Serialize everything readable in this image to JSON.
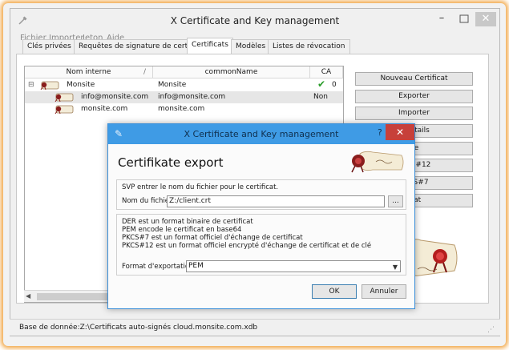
{
  "main_window": {
    "title": "X Certificate and Key management",
    "menu": [
      "Fichier",
      "Importer",
      "Jeton",
      "Aide"
    ],
    "tabs": [
      {
        "label": "Clés privées",
        "active": false
      },
      {
        "label": "Requêtes de signature de certificat",
        "active": false
      },
      {
        "label": "Certificats",
        "active": true
      },
      {
        "label": "Modèles",
        "active": false
      },
      {
        "label": "Listes de révocation",
        "active": false
      }
    ],
    "list": {
      "columns": [
        "Nom interne",
        "commonName",
        "CA"
      ],
      "rows": [
        {
          "name": "Monsite",
          "common_name": "Monsite",
          "ca": "0",
          "ca_check": true,
          "expand": "⊟"
        },
        {
          "name": "info@monsite.com",
          "common_name": "info@monsite.com",
          "ca": "Non"
        },
        {
          "name": "monsite.com",
          "common_name": "monsite.com",
          "ca": ""
        }
      ]
    },
    "buttons": [
      "Nouveau Certificat",
      "Exporter",
      "Importer",
      "s Détails",
      "ire",
      "PKCS#12",
      "PKCS#7",
      "plat"
    ],
    "status": "Base de donnée:Z:\\Certificats auto-signés cloud.monsite.com.xdb"
  },
  "dialog": {
    "title": "X Certificate and Key management",
    "help": "?",
    "close": "✕",
    "heading": "Certifikate export",
    "instruction": "SVP entrer le nom du fichier pour le certificat.",
    "filename_label": "Nom du fichier",
    "filename_value": "Z:/client.crt",
    "browse_label": "...",
    "format_info": [
      "DER est un format binaire de certificat",
      "PEM encode le certificat en base64",
      "PKCS#7 est un format officiel d'échange de certificat",
      "PKCS#12 est un format officiel encrypté d'échange de certificat et de clé"
    ],
    "format_label": "Format d'exportation",
    "format_value": "PEM",
    "ok_label": "OK",
    "cancel_label": "Annuler"
  },
  "colors": {
    "dialog_title": "#3f9be5",
    "close_red": "#c7403a",
    "glow": "#f2a94a",
    "check_green": "#2a9d2a"
  }
}
